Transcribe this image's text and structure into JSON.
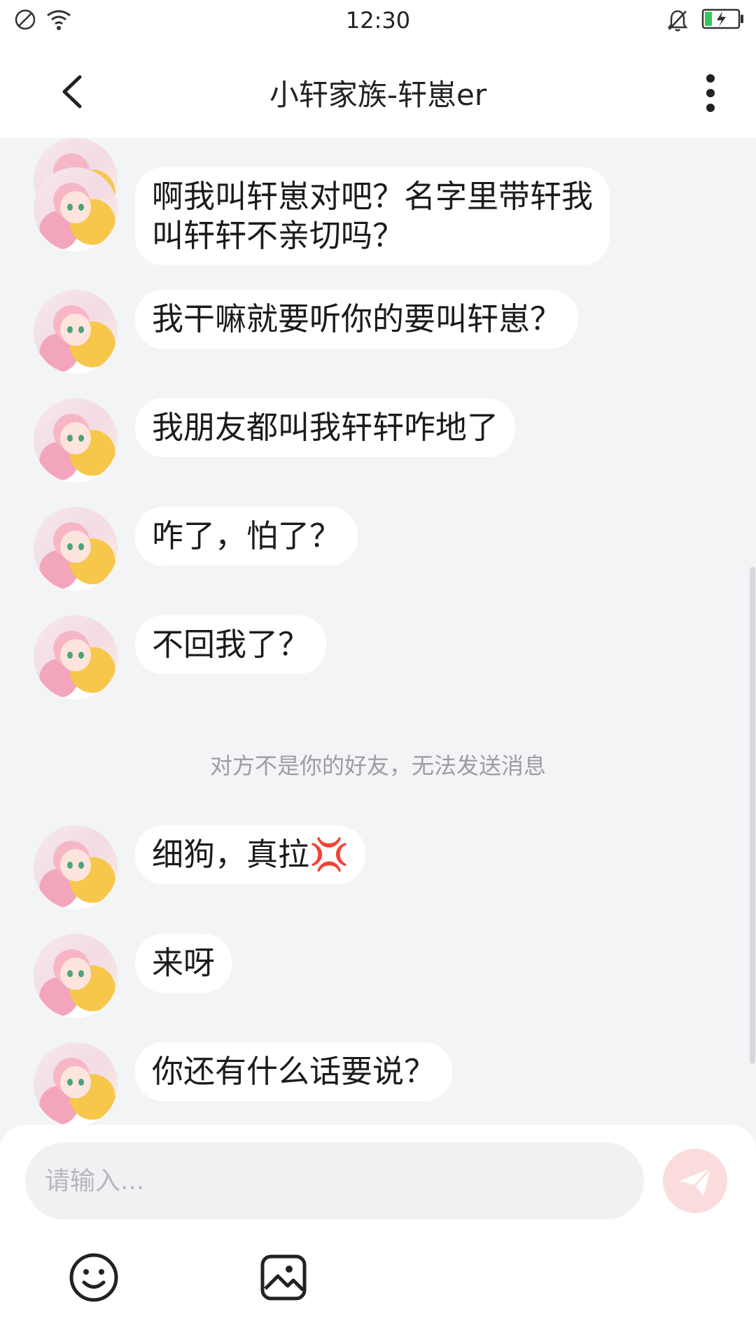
{
  "status_bar": {
    "time": "12:30",
    "icons": [
      "dnd-icon",
      "wifi-icon",
      "mute-bell-icon",
      "battery-charging-icon"
    ],
    "battery_color": "#34c759"
  },
  "header": {
    "title": "小轩家族-轩崽er",
    "back_icon": "chevron-left-icon",
    "more_icon": "more-vertical-icon"
  },
  "messages": [
    {
      "text": "啊我叫轩崽对吧？名字里带轩我\n叫轩轩不亲切吗？"
    },
    {
      "text": "我干嘛就要听你的要叫轩崽？"
    },
    {
      "text": "我朋友都叫我轩轩咋地了"
    },
    {
      "text": "咋了，怕了？"
    },
    {
      "text": "不回我了？"
    },
    {
      "text": "细狗，真拉💢"
    },
    {
      "text": "来呀"
    },
    {
      "text": "你还有什么话要说？"
    }
  ],
  "system_notice": "对方不是你的好友，无法发送消息",
  "composer": {
    "placeholder": "请输入...",
    "send_icon": "send-icon",
    "emoji_icon": "emoji-icon",
    "image_icon": "image-icon",
    "accent_color": "#f5b6b6"
  }
}
